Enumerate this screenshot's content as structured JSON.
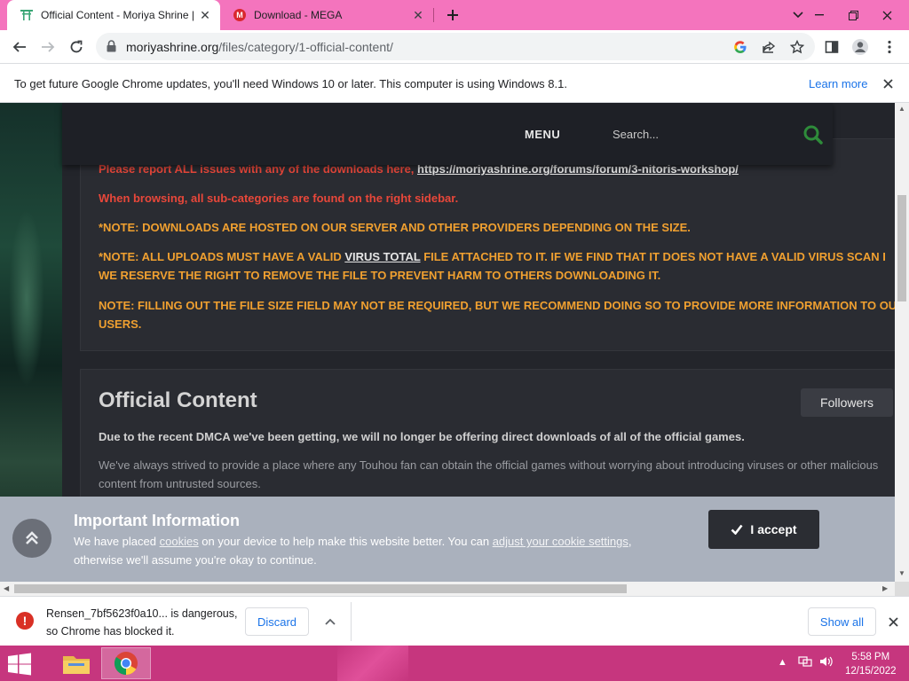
{
  "browser": {
    "tabs": [
      {
        "title": "Official Content - Moriya Shrine |",
        "active": true
      },
      {
        "title": "Download - MEGA",
        "active": false
      }
    ],
    "url": {
      "host": "moriyashrine.org",
      "path": "/files/category/1-official-content/"
    },
    "infobar": {
      "message": "To get future Google Chrome updates, you'll need Windows 10 or later. This computer is using Windows 8.1.",
      "link": "Learn more"
    },
    "colors": {
      "tabstrip": "#f474bd",
      "link": "#1a73e8"
    }
  },
  "site": {
    "header": {
      "menu": "MENU",
      "search_placeholder": "Search..."
    },
    "notes": [
      {
        "text": "Please report ALL issues with any of the downloads here,",
        "link": "https://moriyashrine.org/forums/forum/3-nitoris-workshop/"
      },
      {
        "text": "When browsing, all sub-categories are found on the right sidebar."
      },
      {
        "text": "*NOTE: DOWNLOADS ARE HOSTED ON OUR SERVER AND OTHER PROVIDERS DEPENDING ON THE SIZE."
      },
      {
        "pre": "*NOTE: ALL UPLOADS MUST HAVE A VALID ",
        "link": "VIRUS TOTAL",
        "post": " FILE ATTACHED TO IT. IF WE FIND THAT IT DOES NOT HAVE A VALID VIRUS SCAN I",
        "line2": "WE RESERVE THE RIGHT TO REMOVE THE FILE TO PREVENT HARM TO OTHERS DOWNLOADING IT."
      },
      {
        "text": "NOTE: FILLING OUT THE FILE SIZE FIELD MAY NOT BE REQUIRED, BUT WE RECOMMEND DOING SO TO PROVIDE MORE INFORMATION TO OUR",
        "line2": "USERS."
      }
    ],
    "content": {
      "title": "Official Content",
      "followers_label": "Followers",
      "dmca": "Due to the recent DMCA we've been getting, we will no longer be offering direct downloads of all of the official games.",
      "strive": "We've always strived to provide a place where any Touhou fan can obtain the official games without worrying about introducing viruses or other malicious content from untrusted sources."
    },
    "cookie": {
      "title": "Important Information",
      "text_a": "We have placed ",
      "link_a": "cookies",
      "text_b": " on your device to help make this website better. You can ",
      "link_b": "adjust your cookie settings",
      "text_c": ",",
      "text_d": "otherwise we'll assume you're okay to continue.",
      "accept": "I accept"
    },
    "colors": {
      "note_red": "#e8473a",
      "note_orange": "#f0a030",
      "search_icon": "#2e8b3a"
    }
  },
  "downloads": {
    "filename": "Rensen_7bf5623f0a10...",
    "status": "is dangerous,",
    "status2": "so Chrome has blocked it.",
    "discard": "Discard",
    "show_all": "Show all"
  },
  "taskbar": {
    "time": "5:58 PM",
    "date": "12/15/2022",
    "color": "#c6367e"
  }
}
